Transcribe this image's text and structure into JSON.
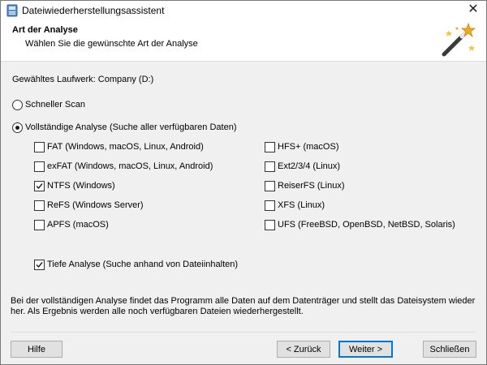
{
  "window": {
    "title": "Dateiwiederherstellungsassistent"
  },
  "header": {
    "title": "Art der Analyse",
    "subtitle": "Wählen Sie die gewünschte Art der Analyse"
  },
  "selected_drive": "Gewähltes Laufwerk: Company (D:)",
  "scan_options": {
    "quick": {
      "label": "Schneller Scan",
      "selected": false
    },
    "full": {
      "label": "Vollständige Analyse (Suche aller verfügbaren Daten)",
      "selected": true
    }
  },
  "filesystems_left": [
    {
      "label": "FAT (Windows, macOS, Linux, Android)",
      "checked": false
    },
    {
      "label": "exFAT (Windows, macOS, Linux, Android)",
      "checked": false
    },
    {
      "label": "NTFS (Windows)",
      "checked": true
    },
    {
      "label": "ReFS (Windows Server)",
      "checked": false
    },
    {
      "label": "APFS (macOS)",
      "checked": false
    }
  ],
  "filesystems_right": [
    {
      "label": "HFS+ (macOS)",
      "checked": false
    },
    {
      "label": "Ext2/3/4 (Linux)",
      "checked": false
    },
    {
      "label": "ReiserFS (Linux)",
      "checked": false
    },
    {
      "label": "XFS (Linux)",
      "checked": false
    },
    {
      "label": "UFS (FreeBSD, OpenBSD, NetBSD, Solaris)",
      "checked": false
    }
  ],
  "deep_analysis": {
    "label": "Tiefe Analyse (Suche anhand von Dateiinhalten)",
    "checked": true
  },
  "description": "Bei der vollständigen Analyse findet das Programm alle Daten auf dem Datenträger und stellt das Dateisystem wieder her. Als Ergebnis werden alle noch verfügbaren Dateien wiederhergestellt.",
  "buttons": {
    "help": "Hilfe",
    "back": "< Zurück",
    "next": "Weiter >",
    "close": "Schließen"
  },
  "icons": {
    "app": "app-icon",
    "close": "close-icon",
    "wizard": "magic-wand-icon"
  }
}
